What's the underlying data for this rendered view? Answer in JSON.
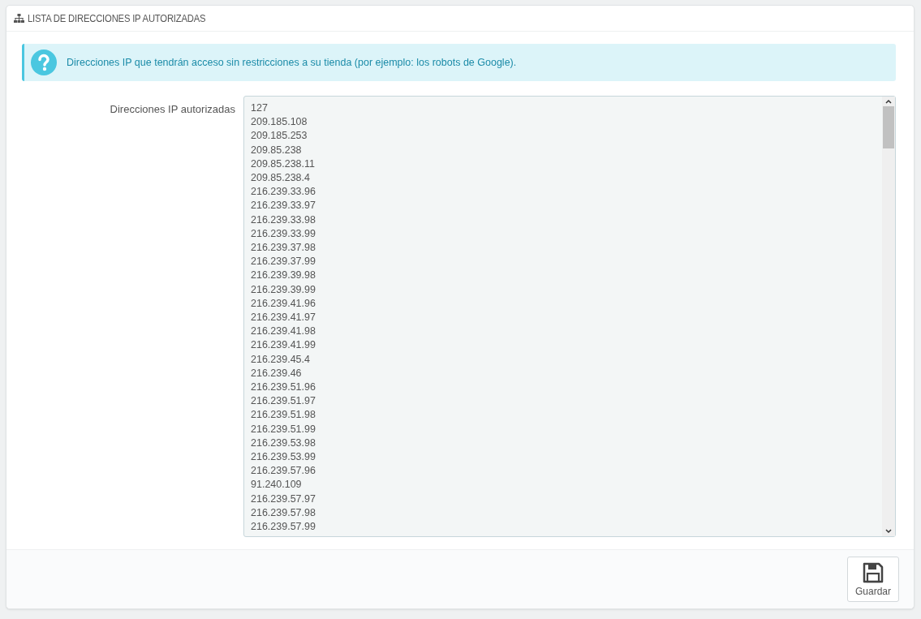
{
  "panel": {
    "title": "LISTA DE DIRECCIONES IP AUTORIZADAS"
  },
  "alert": {
    "text": "Direcciones IP que tendrán acceso sin restricciones a su tienda (por ejemplo: los robots de Google)."
  },
  "field": {
    "label": "Direcciones IP autorizadas",
    "lines": [
      "127",
      "209.185.108",
      "209.185.253",
      "209.85.238",
      "209.85.238.11",
      "209.85.238.4",
      "216.239.33.96",
      "216.239.33.97",
      "216.239.33.98",
      "216.239.33.99",
      "216.239.37.98",
      "216.239.37.99",
      "216.239.39.98",
      "216.239.39.99",
      "216.239.41.96",
      "216.239.41.97",
      "216.239.41.98",
      "216.239.41.99",
      "216.239.45.4",
      "216.239.46",
      "216.239.51.96",
      "216.239.51.97",
      "216.239.51.98",
      "216.239.51.99",
      "216.239.53.98",
      "216.239.53.99",
      "216.239.57.96",
      "91.240.109",
      "216.239.57.97",
      "216.239.57.98",
      "216.239.57.99"
    ]
  },
  "footer": {
    "save_button": "Guardar"
  }
}
